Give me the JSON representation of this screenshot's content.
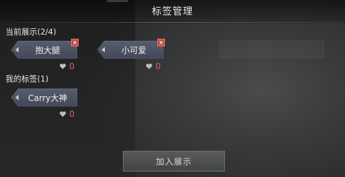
{
  "header": {
    "title": "标签管理"
  },
  "display_section": {
    "label": "当前展示(2/4)",
    "tags": [
      {
        "text": "抱大腿",
        "likes": "0",
        "removable": true
      },
      {
        "text": "小可爱",
        "likes": "0",
        "removable": true
      }
    ]
  },
  "my_section": {
    "label": "我的标签(1)",
    "tags": [
      {
        "text": "Carry大神",
        "likes": "0",
        "removable": false
      }
    ]
  },
  "actions": {
    "add_to_display": "加入展示"
  },
  "colors": {
    "like_count": "#e0605a",
    "remove_button": "#c04a3f",
    "tag_fill": "#4d5262"
  },
  "icons": {
    "like": "heart-icon",
    "remove": "close-icon",
    "tag_marker": "triangle-icon"
  }
}
